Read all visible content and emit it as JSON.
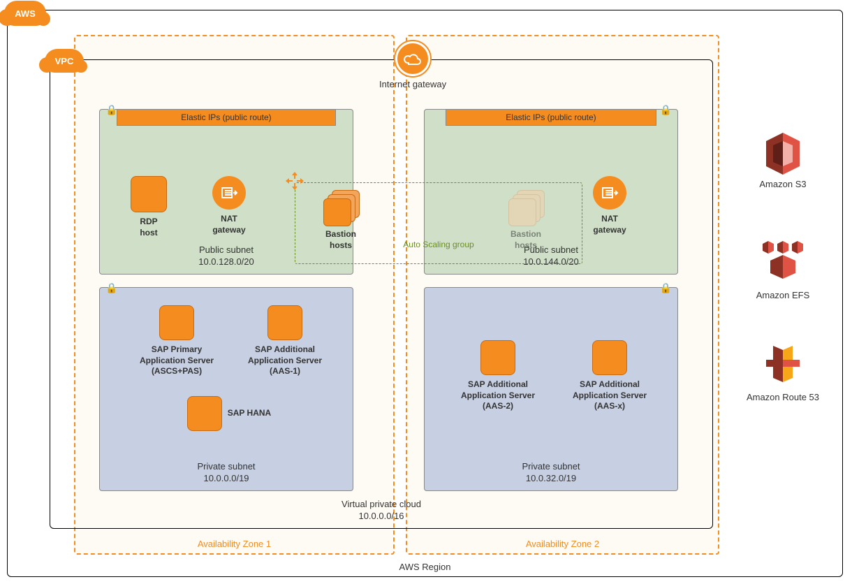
{
  "region": {
    "label": "AWS Region",
    "badge": "AWS"
  },
  "vpc": {
    "badge": "VPC",
    "title": "Virtual private cloud",
    "cidr": "10.0.0.0/16"
  },
  "igw": {
    "label": "Internet  gateway"
  },
  "az": {
    "z1": "Availability Zone 1",
    "z2": "Availability Zone 2"
  },
  "asg": {
    "label": "Auto Scaling group"
  },
  "subnets": {
    "pub1": {
      "header": "Elastic IPs (public route)",
      "title": "Public subnet",
      "cidr": "10.0.128.0/20"
    },
    "pub2": {
      "header": "Elastic IPs (public route)",
      "title": "Public subnet",
      "cidr": "10.0.144.0/20"
    },
    "priv1": {
      "title": "Private subnet",
      "cidr": "10.0.0.0/19"
    },
    "priv2": {
      "title": "Private subnet",
      "cidr": "10.0.32.0/19"
    }
  },
  "nodes": {
    "rdp": "RDP\nhost",
    "nat1": "NAT\ngateway",
    "nat2": "NAT\ngateway",
    "bastion1": "Bastion\nhosts",
    "bastion2": "Bastion\nhosts",
    "pas": "SAP Primary\nApplication Server\n(ASCS+PAS)",
    "aas1": "SAP Additional\nApplication Server\n(AAS-1)",
    "hana": "SAP HANA",
    "aas2": "SAP Additional\nApplication Server\n(AAS-2)",
    "aasx": "SAP Additional\nApplication Server\n(AAS-x)"
  },
  "side": {
    "s3": "Amazon S3",
    "efs": "Amazon EFS",
    "r53": "Amazon Route 53"
  }
}
